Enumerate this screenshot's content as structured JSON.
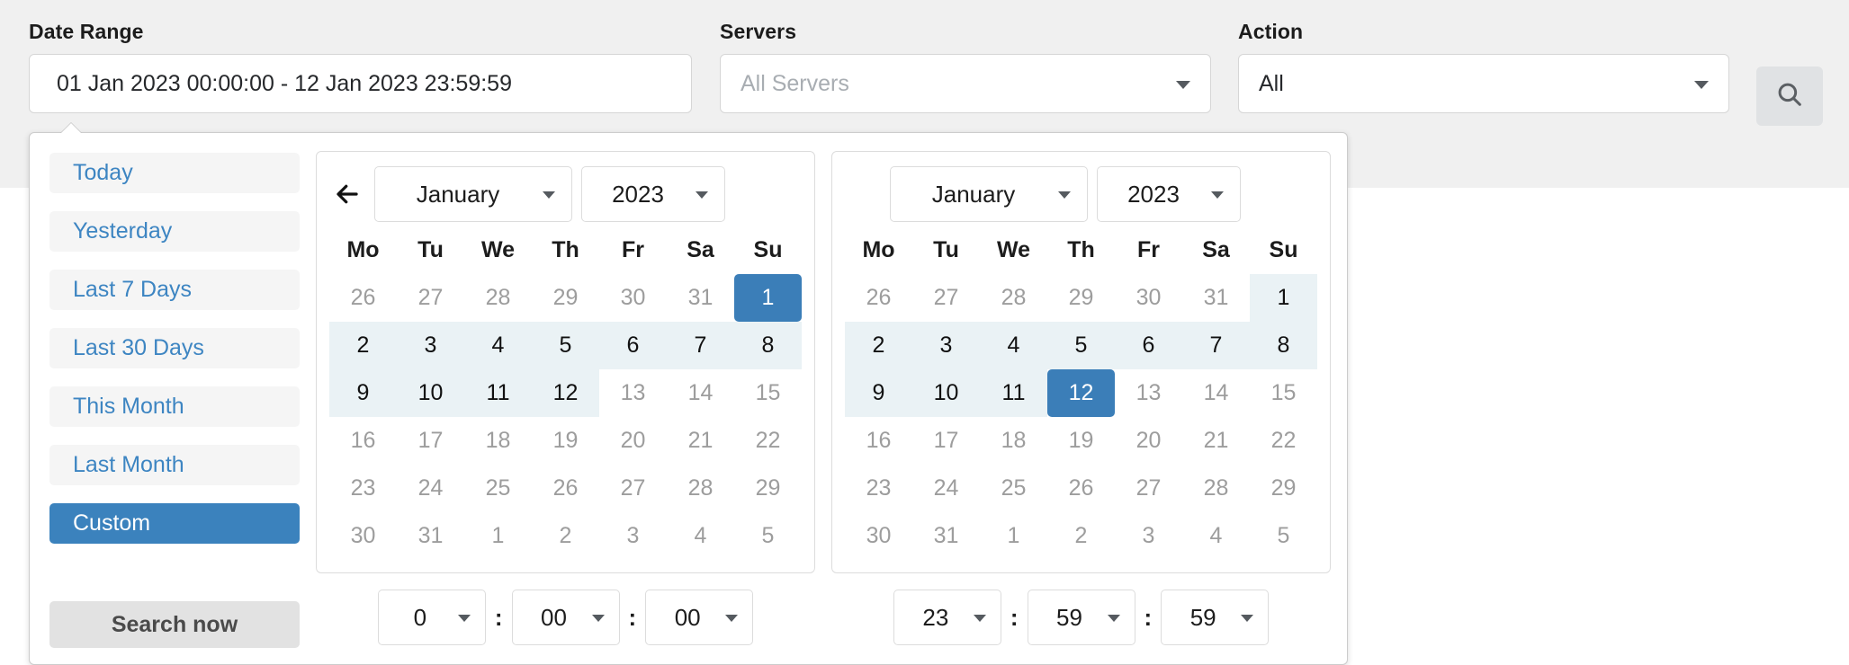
{
  "toolbar": {
    "date_range": {
      "label": "Date Range",
      "value": "01 Jan 2023 00:00:00 - 12 Jan 2023 23:59:59"
    },
    "servers": {
      "label": "Servers",
      "value": "All Servers",
      "is_placeholder": true
    },
    "action": {
      "label": "Action",
      "value": "All",
      "is_placeholder": false
    },
    "search_button": {
      "icon": "search-icon",
      "label": ""
    }
  },
  "daterange_panel": {
    "ranges": [
      {
        "label": "Today",
        "active": false
      },
      {
        "label": "Yesterday",
        "active": false
      },
      {
        "label": "Last 7 Days",
        "active": false
      },
      {
        "label": "Last 30 Days",
        "active": false
      },
      {
        "label": "This Month",
        "active": false
      },
      {
        "label": "Last Month",
        "active": false
      },
      {
        "label": "Custom",
        "active": true
      }
    ],
    "search_now_label": "Search now",
    "weekday_headers": [
      "Mo",
      "Tu",
      "We",
      "Th",
      "Fr",
      "Sa",
      "Su"
    ],
    "calendars": [
      {
        "name": "start-calendar",
        "has_prev_arrow": true,
        "prev_arrow_icon": "arrow-left-icon",
        "has_next_arrow": false,
        "month": "January",
        "year": "2023",
        "weeks": [
          [
            {
              "d": "26",
              "state": "other"
            },
            {
              "d": "27",
              "state": "other"
            },
            {
              "d": "28",
              "state": "other"
            },
            {
              "d": "29",
              "state": "other"
            },
            {
              "d": "30",
              "state": "other"
            },
            {
              "d": "31",
              "state": "other"
            },
            {
              "d": "1",
              "state": "selected"
            }
          ],
          [
            {
              "d": "2",
              "state": "inrange"
            },
            {
              "d": "3",
              "state": "inrange"
            },
            {
              "d": "4",
              "state": "inrange"
            },
            {
              "d": "5",
              "state": "inrange"
            },
            {
              "d": "6",
              "state": "inrange"
            },
            {
              "d": "7",
              "state": "inrange"
            },
            {
              "d": "8",
              "state": "inrange"
            }
          ],
          [
            {
              "d": "9",
              "state": "inrange"
            },
            {
              "d": "10",
              "state": "inrange"
            },
            {
              "d": "11",
              "state": "inrange"
            },
            {
              "d": "12",
              "state": "inrange"
            },
            {
              "d": "13",
              "state": "other"
            },
            {
              "d": "14",
              "state": "other"
            },
            {
              "d": "15",
              "state": "other"
            }
          ],
          [
            {
              "d": "16",
              "state": "other"
            },
            {
              "d": "17",
              "state": "other"
            },
            {
              "d": "18",
              "state": "other"
            },
            {
              "d": "19",
              "state": "other"
            },
            {
              "d": "20",
              "state": "other"
            },
            {
              "d": "21",
              "state": "other"
            },
            {
              "d": "22",
              "state": "other"
            }
          ],
          [
            {
              "d": "23",
              "state": "other"
            },
            {
              "d": "24",
              "state": "other"
            },
            {
              "d": "25",
              "state": "other"
            },
            {
              "d": "26",
              "state": "other"
            },
            {
              "d": "27",
              "state": "other"
            },
            {
              "d": "28",
              "state": "other"
            },
            {
              "d": "29",
              "state": "other"
            }
          ],
          [
            {
              "d": "30",
              "state": "other"
            },
            {
              "d": "31",
              "state": "other"
            },
            {
              "d": "1",
              "state": "other"
            },
            {
              "d": "2",
              "state": "other"
            },
            {
              "d": "3",
              "state": "other"
            },
            {
              "d": "4",
              "state": "other"
            },
            {
              "d": "5",
              "state": "other"
            }
          ]
        ],
        "time": {
          "hour": "0",
          "minute": "00",
          "second": "00"
        }
      },
      {
        "name": "end-calendar",
        "has_prev_arrow": false,
        "prev_arrow_icon": "arrow-left-icon",
        "has_next_arrow": false,
        "month": "January",
        "year": "2023",
        "weeks": [
          [
            {
              "d": "26",
              "state": "other"
            },
            {
              "d": "27",
              "state": "other"
            },
            {
              "d": "28",
              "state": "other"
            },
            {
              "d": "29",
              "state": "other"
            },
            {
              "d": "30",
              "state": "other"
            },
            {
              "d": "31",
              "state": "other"
            },
            {
              "d": "1",
              "state": "inrange"
            }
          ],
          [
            {
              "d": "2",
              "state": "inrange"
            },
            {
              "d": "3",
              "state": "inrange"
            },
            {
              "d": "4",
              "state": "inrange"
            },
            {
              "d": "5",
              "state": "inrange"
            },
            {
              "d": "6",
              "state": "inrange"
            },
            {
              "d": "7",
              "state": "inrange"
            },
            {
              "d": "8",
              "state": "inrange"
            }
          ],
          [
            {
              "d": "9",
              "state": "inrange"
            },
            {
              "d": "10",
              "state": "inrange"
            },
            {
              "d": "11",
              "state": "inrange"
            },
            {
              "d": "12",
              "state": "selected"
            },
            {
              "d": "13",
              "state": "other"
            },
            {
              "d": "14",
              "state": "other"
            },
            {
              "d": "15",
              "state": "other"
            }
          ],
          [
            {
              "d": "16",
              "state": "other"
            },
            {
              "d": "17",
              "state": "other"
            },
            {
              "d": "18",
              "state": "other"
            },
            {
              "d": "19",
              "state": "other"
            },
            {
              "d": "20",
              "state": "other"
            },
            {
              "d": "21",
              "state": "other"
            },
            {
              "d": "22",
              "state": "other"
            }
          ],
          [
            {
              "d": "23",
              "state": "other"
            },
            {
              "d": "24",
              "state": "other"
            },
            {
              "d": "25",
              "state": "other"
            },
            {
              "d": "26",
              "state": "other"
            },
            {
              "d": "27",
              "state": "other"
            },
            {
              "d": "28",
              "state": "other"
            },
            {
              "d": "29",
              "state": "other"
            }
          ],
          [
            {
              "d": "30",
              "state": "other"
            },
            {
              "d": "31",
              "state": "other"
            },
            {
              "d": "1",
              "state": "other"
            },
            {
              "d": "2",
              "state": "other"
            },
            {
              "d": "3",
              "state": "other"
            },
            {
              "d": "4",
              "state": "other"
            },
            {
              "d": "5",
              "state": "other"
            }
          ]
        ],
        "time": {
          "hour": "23",
          "minute": "59",
          "second": "59"
        }
      }
    ],
    "time_separator": ":"
  },
  "colors": {
    "accent": "#3b7eb8",
    "range_highlight": "#eaf2f5",
    "toolbar_bg": "#f0f0f0",
    "link": "#3d85c2"
  }
}
